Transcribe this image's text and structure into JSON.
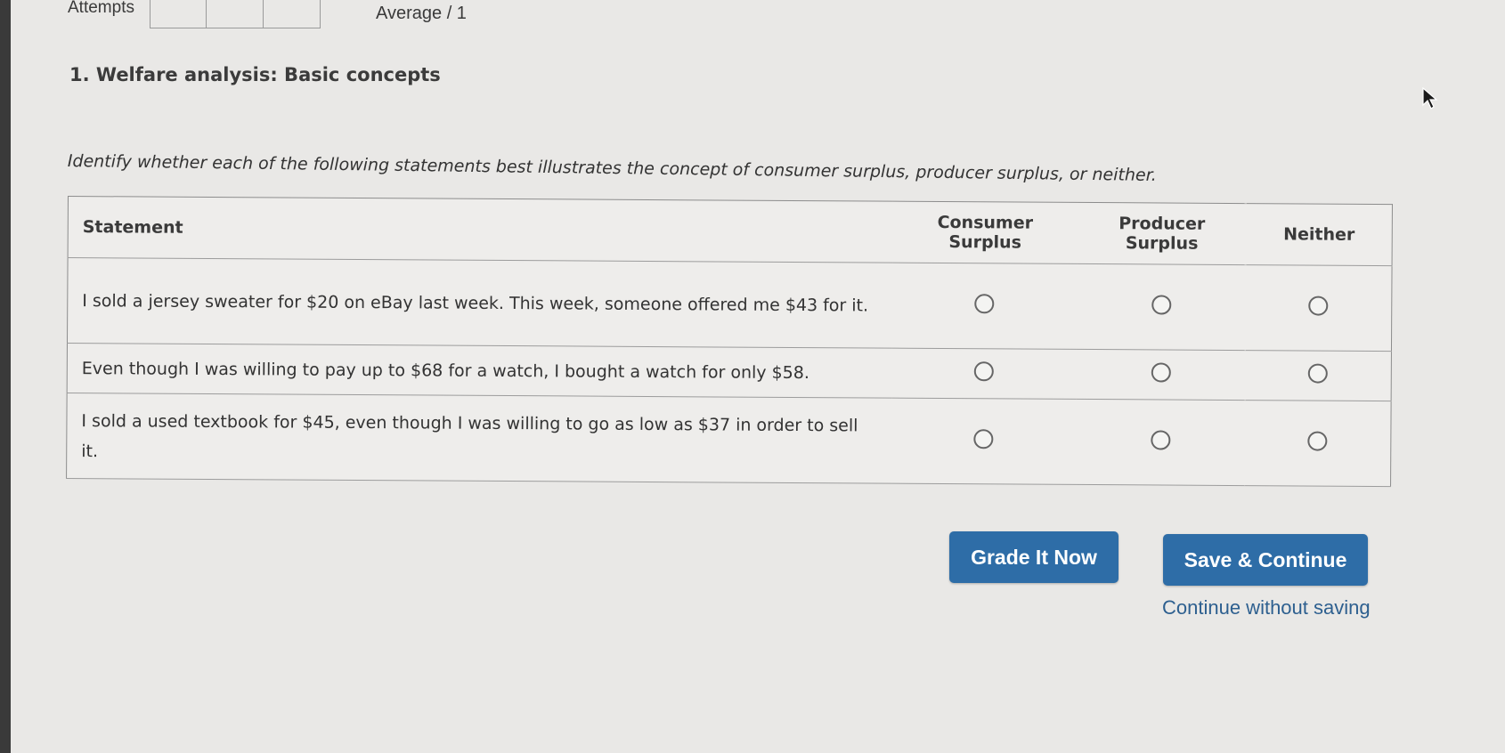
{
  "header": {
    "attempts_label": "Attempts",
    "average_label": "Average / 1"
  },
  "question": {
    "title": "1. Welfare analysis: Basic concepts",
    "instructions": "Identify whether each of the following statements best illustrates the concept of consumer surplus, producer surplus, or neither."
  },
  "table": {
    "headers": {
      "statement": "Statement",
      "consumer_line1": "Consumer",
      "consumer_line2": "Surplus",
      "producer_line1": "Producer",
      "producer_line2": "Surplus",
      "neither": "Neither"
    },
    "rows": [
      {
        "statement": "I sold a jersey sweater for $20 on eBay last week. This week, someone offered me $43 for it.",
        "selected": null
      },
      {
        "statement": "Even though I was willing to pay up to $68 for a watch, I bought a watch for only $58.",
        "selected": null
      },
      {
        "statement": "I sold a used textbook for $45, even though I was willing to go as low as $37 in order to sell it.",
        "selected": null
      }
    ]
  },
  "actions": {
    "grade_label": "Grade It Now",
    "save_label": "Save & Continue",
    "continue_label": "Continue without saving"
  },
  "colors": {
    "button_blue": "#2e6da7",
    "link_blue": "#2d5f8f",
    "background": "#e9e8e6"
  },
  "icons": {
    "cursor": "mouse-pointer-icon",
    "radio": "radio-unchecked-icon"
  }
}
